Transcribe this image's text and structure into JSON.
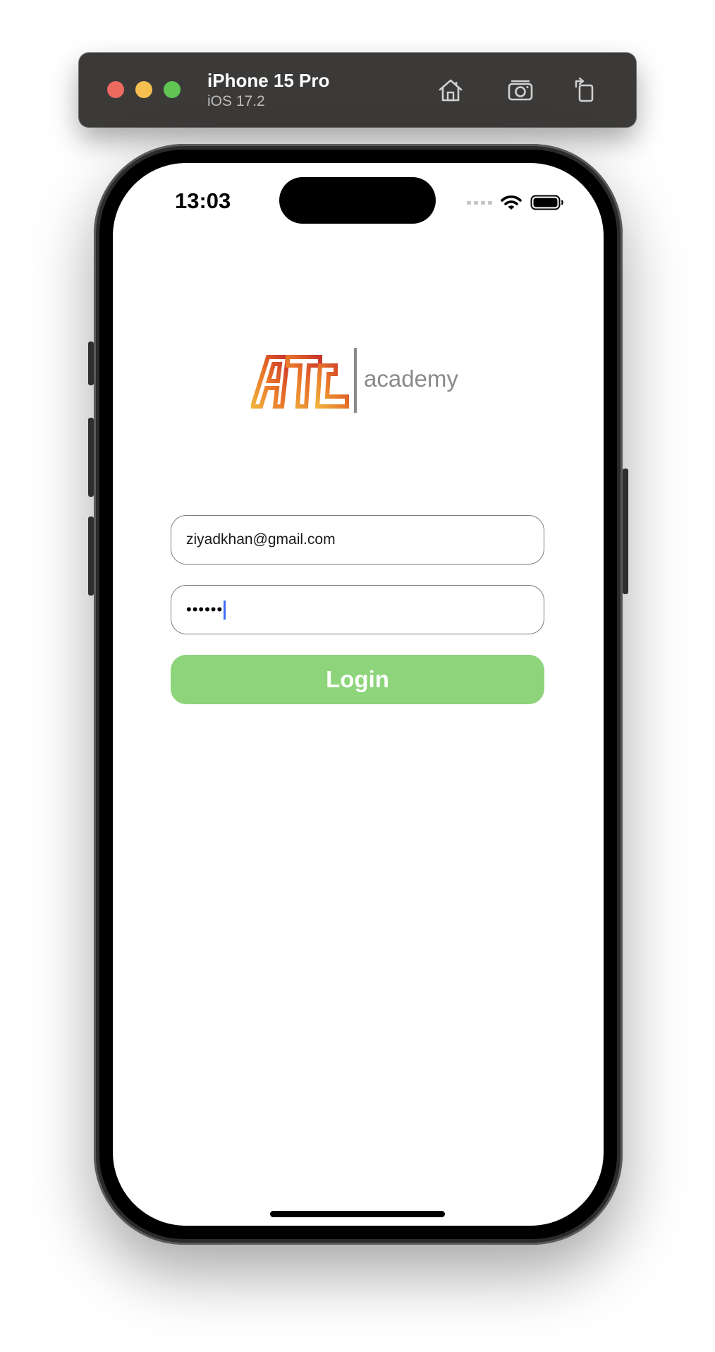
{
  "simulator": {
    "device_name": "iPhone 15 Pro",
    "os_version": "iOS 17.2",
    "toolbar_icons": [
      "home-icon",
      "screenshot-icon",
      "rotate-icon"
    ]
  },
  "status_bar": {
    "time": "13:03"
  },
  "logo": {
    "brand_mark": "ATL",
    "brand_word": "academy",
    "colors": {
      "mark_primary": "#e8742a",
      "mark_secondary": "#f0b23a",
      "word": "#8a8a8a"
    }
  },
  "login_form": {
    "email_value": "ziyadkhan@gmail.com",
    "password_masked": "••••••",
    "login_label": "Login"
  },
  "colors": {
    "login_button": "#8dd47a",
    "field_border": "#7a7a7a",
    "caret": "#3b6cf6"
  }
}
